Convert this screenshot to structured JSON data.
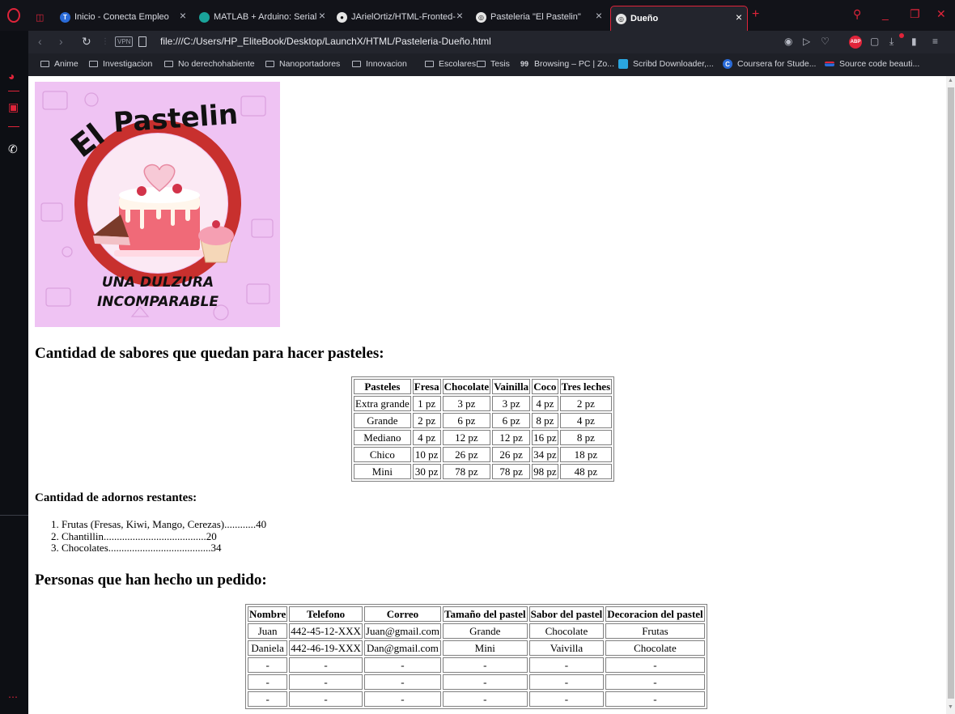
{
  "browser": {
    "tabs": [
      {
        "label": "Inicio - Conecta Empleo",
        "icon": "conecta-empleo-icon",
        "active": false
      },
      {
        "label": "MATLAB + Arduino: Serial I",
        "icon": "matlab-icon",
        "active": false
      },
      {
        "label": "JArielOrtiz/HTML-Fronted-I",
        "icon": "github-icon",
        "active": false
      },
      {
        "label": "Pasteleria \"El Pastelin\"",
        "icon": "globe-icon",
        "active": false
      },
      {
        "label": "Dueño",
        "icon": "globe-icon",
        "active": true
      }
    ],
    "url": "file:///C:/Users/HP_EliteBook/Desktop/LaunchX/HTML/Pasteleria-Dueño.html",
    "vpn_label": "VPN",
    "abp_label": "ABP",
    "bookmarks": [
      {
        "label": "Anime",
        "icon": "folder-icon"
      },
      {
        "label": "Investigacion",
        "icon": "folder-icon"
      },
      {
        "label": "No derechohabiente",
        "icon": "folder-icon"
      },
      {
        "label": "Nanoportadores",
        "icon": "folder-icon"
      },
      {
        "label": "Innovacion",
        "icon": "folder-icon"
      },
      {
        "label": "Escolares",
        "icon": "folder-icon"
      },
      {
        "label": "Tesis",
        "icon": "folder-icon"
      },
      {
        "label": "Browsing – PC | Zo...",
        "icon": "zotero-icon"
      },
      {
        "label": "Scribd Downloader,...",
        "icon": "scribd-icon"
      },
      {
        "label": "Coursera for Stude...",
        "icon": "coursera-icon"
      },
      {
        "label": "Source code beauti...",
        "icon": "menu-lines-icon"
      }
    ],
    "accent": "#e0243a"
  },
  "logo": {
    "top_text": "El Pastelin",
    "bottom_line1": "UNA DULZURA",
    "bottom_line2": "INCOMPARABLE",
    "background": "#efc3f3"
  },
  "sabores": {
    "heading": "Cantidad de sabores que quedan para hacer pasteles:",
    "headers": [
      "Pasteles",
      "Fresa",
      "Chocolate",
      "Vainilla",
      "Coco",
      "Tres leches"
    ],
    "rows": [
      [
        "Extra grande",
        "1 pz",
        "3 pz",
        "3 pz",
        "4 pz",
        "2 pz"
      ],
      [
        "Grande",
        "2 pz",
        "6 pz",
        "6 pz",
        "8 pz",
        "4 pz"
      ],
      [
        "Mediano",
        "4 pz",
        "12 pz",
        "12 pz",
        "16 pz",
        "8 pz"
      ],
      [
        "Chico",
        "10 pz",
        "26 pz",
        "26 pz",
        "34 pz",
        "18 pz"
      ],
      [
        "Mini",
        "30 pz",
        "78 pz",
        "78 pz",
        "98 pz",
        "48 pz"
      ]
    ]
  },
  "adornos": {
    "heading": "Cantidad de adornos restantes:",
    "items": [
      "1. Frutas (Fresas, Kiwi, Mango, Cerezas)............40",
      "2. Chantillin.......................................20",
      "3. Chocolates.......................................34"
    ]
  },
  "personas": {
    "heading": "Personas que han hecho un pedido:",
    "headers": [
      "Nombre",
      "Telefono",
      "Correo",
      "Tamaño del pastel",
      "Sabor del pastel",
      "Decoracion del pastel"
    ],
    "rows": [
      [
        "Juan",
        "442-45-12-XXX",
        "Juan@gmail.com",
        "Grande",
        "Chocolate",
        "Frutas"
      ],
      [
        "Daniela",
        "442-46-19-XXX",
        "Dan@gmail.com",
        "Mini",
        "Vaivilla",
        "Chocolate"
      ],
      [
        "-",
        "-",
        "-",
        "-",
        "-",
        "-"
      ],
      [
        "-",
        "-",
        "-",
        "-",
        "-",
        "-"
      ],
      [
        "-",
        "-",
        "-",
        "-",
        "-",
        "-"
      ]
    ]
  }
}
